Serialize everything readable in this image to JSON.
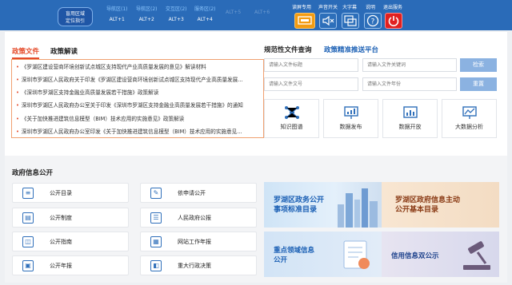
{
  "toolbar": {
    "area_button": [
      "盲用区域",
      "定位指引"
    ],
    "shortcuts": [
      {
        "top": "导航区(1)",
        "key": "ALT+1"
      },
      {
        "top": "导航区(2)",
        "key": "ALT+2"
      },
      {
        "top": "交互区(2)",
        "key": "ALT+3"
      },
      {
        "top": "服务区(2)",
        "key": "ALT+4"
      },
      {
        "top": "",
        "key": "ALT+5"
      },
      {
        "top": "",
        "key": "ALT+6"
      }
    ],
    "tools": [
      "读屏专用",
      "声音开关",
      "大字幕",
      "说明",
      "退出服务"
    ]
  },
  "policy": {
    "tabs": [
      "政策文件",
      "政策解读"
    ],
    "items": [
      "《罗湖区建设营商环境创新试点城区支持现代产业高质量发展的意见》解读材料",
      "深圳市罗湖区人民政府关于印发《罗湖区建设营商环境创新试点城区支持现代产业高质量发展...",
      "《深圳市罗湖区支持金融业高质量发展若干措施》政策解读",
      "深圳市罗湖区人民政府办公室关于印发《深圳市罗湖区支持金融业高质量发展若干措施》的通知",
      "《关于加快推进建筑信息模型（BIM）技术应用的实施意见》政策解读",
      "深圳市罗湖区人民政府办公室印发《关于加快推进建筑信息模型（BIM）技术应用的实施意见..."
    ]
  },
  "search": {
    "tabs": [
      "规范性文件查询",
      "政策精准推送平台"
    ],
    "placeholders": [
      "请输入文件标题",
      "请输入文件关键词",
      "请输入文件文号",
      "请输入文件年份"
    ],
    "search_label": "检索",
    "reset_label": "重置"
  },
  "tiles": [
    {
      "label": "知识图谱",
      "icon": "knowledge-graph-icon"
    },
    {
      "label": "数据发布",
      "icon": "data-release-icon"
    },
    {
      "label": "数据开放",
      "icon": "data-open-icon"
    },
    {
      "label": "大数据分析",
      "icon": "big-data-icon"
    }
  ],
  "gov_info": {
    "title": "政府信息公开",
    "items": [
      {
        "label": "公开目录",
        "icon": "catalog-icon"
      },
      {
        "label": "依申请公开",
        "icon": "application-icon"
      },
      {
        "label": "公开制度",
        "icon": "system-icon"
      },
      {
        "label": "人民政府公报",
        "icon": "gazette-icon"
      },
      {
        "label": "公开指南",
        "icon": "guide-icon"
      },
      {
        "label": "网站工作年报",
        "icon": "website-report-icon"
      },
      {
        "label": "公开年报",
        "icon": "annual-report-icon"
      },
      {
        "label": "重大行政决策",
        "icon": "decision-icon"
      }
    ]
  },
  "banners": [
    [
      "罗湖区政务公开",
      "事项标准目录"
    ],
    [
      "罗湖区政府信息主动",
      "公开基本目录"
    ],
    [
      "重点领域信息",
      "公开"
    ],
    [
      "信用信息双公示"
    ]
  ],
  "colors": {
    "toolbar": "#2a6bb8",
    "accent": "#e54b2a",
    "link": "#1a5fb4"
  }
}
